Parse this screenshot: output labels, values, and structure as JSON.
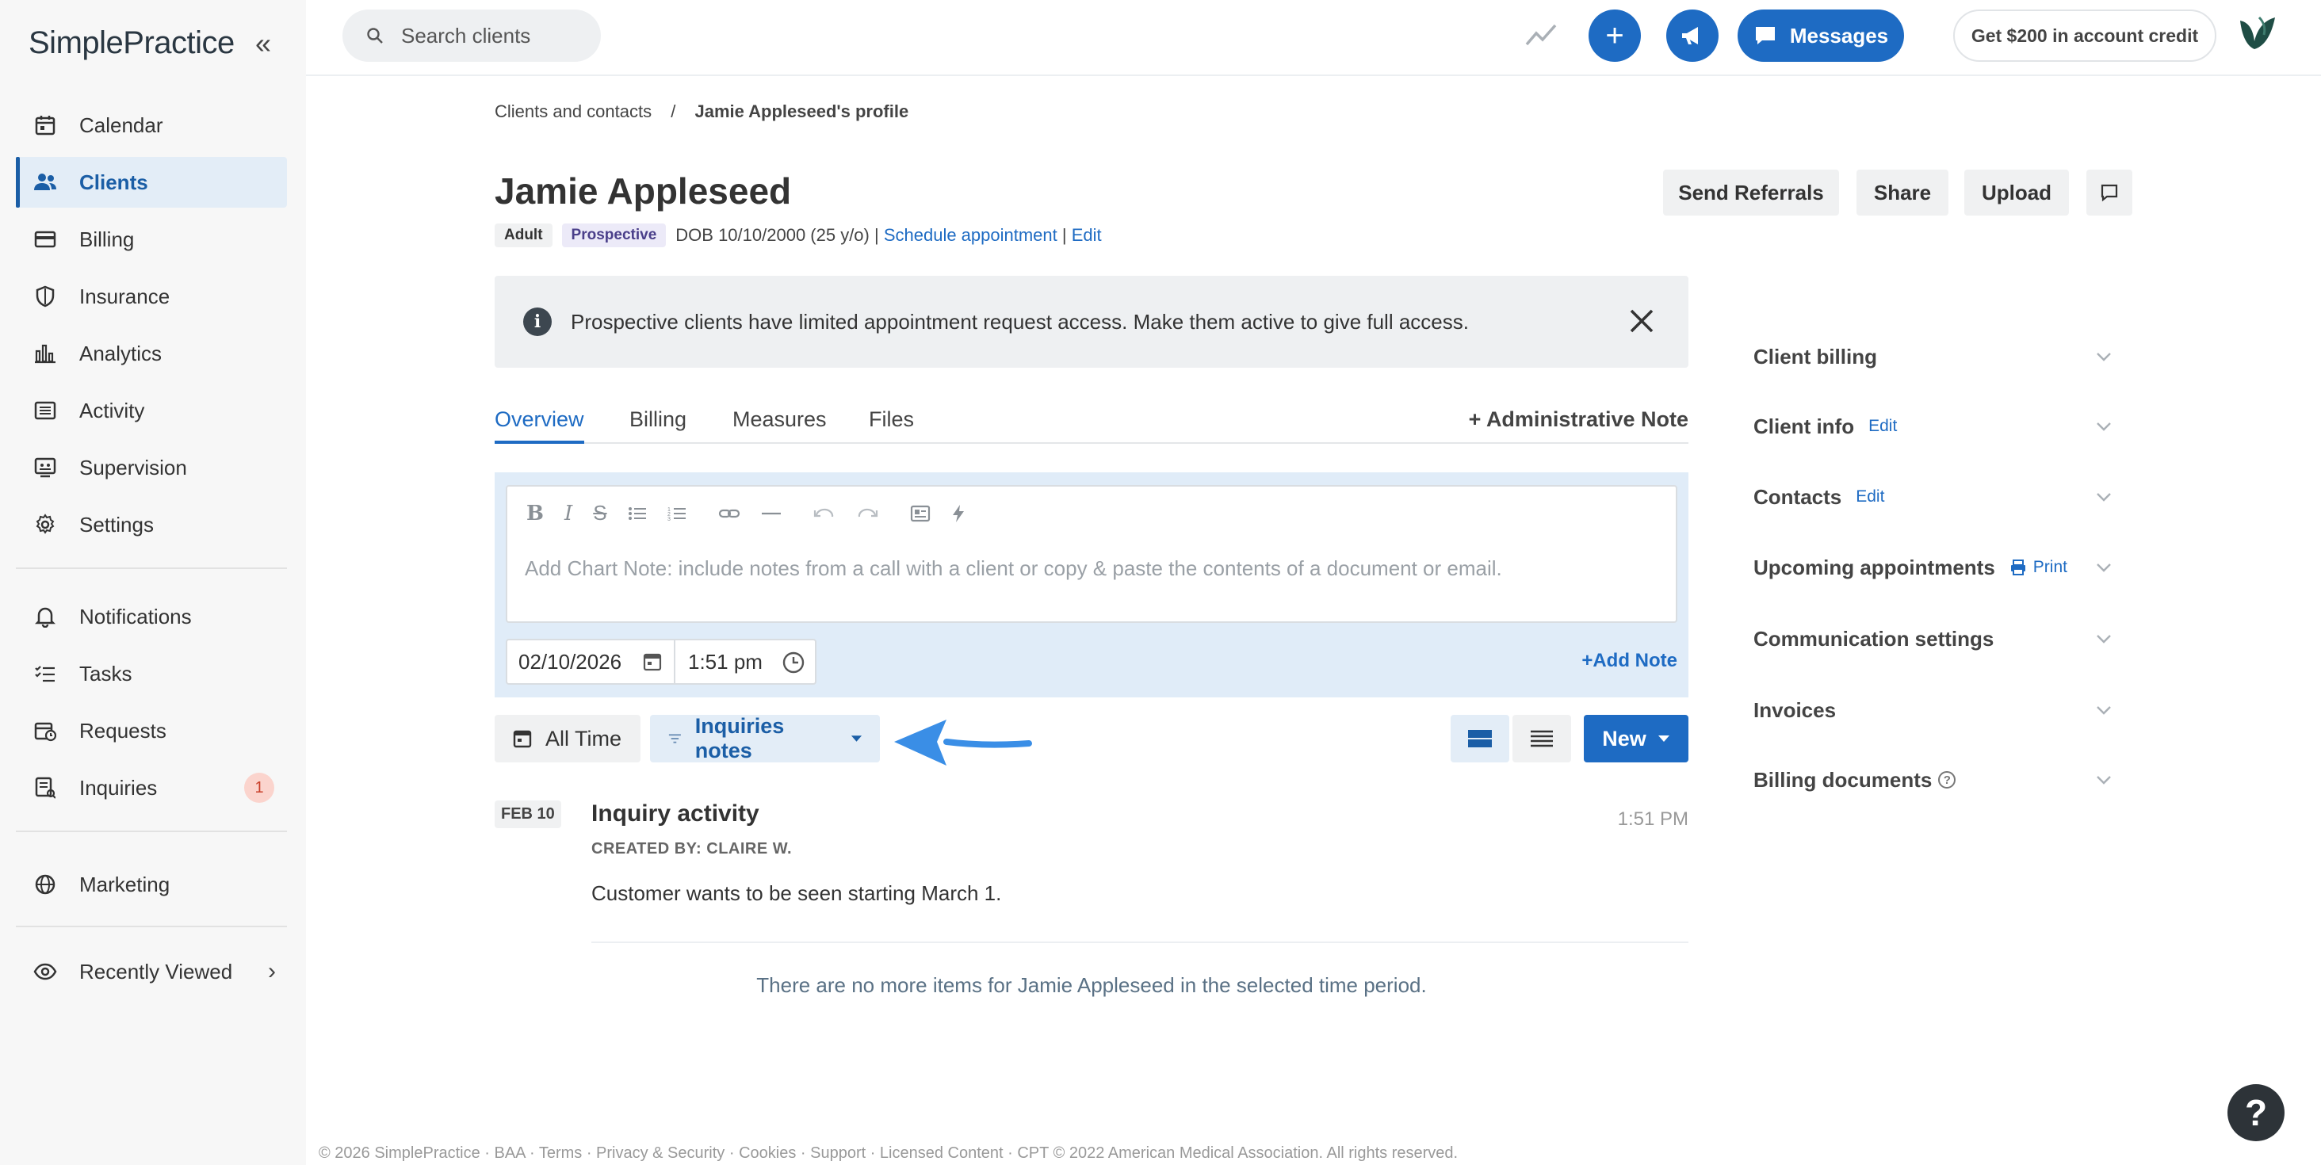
{
  "sidebar": {
    "logo": "SimplePractice",
    "items": [
      {
        "label": "Calendar",
        "icon": "calendar-icon"
      },
      {
        "label": "Clients",
        "icon": "users-icon"
      },
      {
        "label": "Billing",
        "icon": "credit-card-icon"
      },
      {
        "label": "Insurance",
        "icon": "shield-icon"
      },
      {
        "label": "Analytics",
        "icon": "bar-chart-icon"
      },
      {
        "label": "Activity",
        "icon": "list-icon"
      },
      {
        "label": "Supervision",
        "icon": "supervision-icon"
      },
      {
        "label": "Settings",
        "icon": "gear-icon"
      },
      {
        "label": "Notifications",
        "icon": "bell-icon"
      },
      {
        "label": "Tasks",
        "icon": "tasks-icon"
      },
      {
        "label": "Requests",
        "icon": "calendar-clock-icon"
      },
      {
        "label": "Inquiries",
        "icon": "inquiries-icon",
        "badge": "1"
      },
      {
        "label": "Marketing",
        "icon": "globe-icon"
      },
      {
        "label": "Recently Viewed",
        "icon": "eye-icon"
      }
    ],
    "active": "Clients"
  },
  "topbar": {
    "search_placeholder": "Search clients",
    "messages_label": "Messages",
    "credit_label": "Get $200 in account credit"
  },
  "breadcrumb": {
    "parent": "Clients and contacts",
    "separator": "/",
    "current": "Jamie Appleseed's profile"
  },
  "client": {
    "name": "Jamie Appleseed",
    "tags": [
      "Adult",
      "Prospective"
    ],
    "dob": "DOB 10/10/2000 (25 y/o) |",
    "schedule_link": "Schedule appointment",
    "sep": "|",
    "edit_link": "Edit"
  },
  "header_buttons": {
    "send_referrals": "Send Referrals",
    "share": "Share",
    "upload": "Upload"
  },
  "alert": {
    "text": "Prospective clients have limited appointment request access. Make them active to give full access."
  },
  "tabs": [
    "Overview",
    "Billing",
    "Measures",
    "Files"
  ],
  "admin_note": "Administrative Note",
  "editor": {
    "placeholder": "Add Chart Note: include notes from a call with a client or copy & paste the contents of a document or email.",
    "date": "02/10/2026",
    "time": "1:51 pm",
    "add_note": "Add Note"
  },
  "filters": {
    "all_time": "All Time",
    "inquiries_notes": "Inquiries notes",
    "new": "New"
  },
  "feed": {
    "date": "FEB 10",
    "title": "Inquiry activity",
    "created_by": "CREATED BY: CLAIRE W.",
    "time": "1:51 PM",
    "body": "Customer wants to be seen starting March 1.",
    "end_text": "There are no more items for Jamie Appleseed in the selected time period."
  },
  "right_panel": {
    "client_billing": "Client billing",
    "client_info": "Client info",
    "client_info_edit": "Edit",
    "contacts": "Contacts",
    "contacts_edit": "Edit",
    "upcoming": "Upcoming appointments",
    "print": "Print",
    "communication": "Communication settings",
    "invoices": "Invoices",
    "billing_documents": "Billing documents"
  },
  "footer": "© 2026 SimplePractice · BAA · Terms · Privacy & Security · Cookies · Support · Licensed Content · CPT © 2022 American Medical Association. All rights reserved.",
  "help_label": "?",
  "colors": {
    "brand_blue": "#1e6bc3",
    "active_nav_bg": "#e3edf7",
    "badge_bg": "#fbd4cd",
    "editor_bg": "#e0ecf8"
  }
}
